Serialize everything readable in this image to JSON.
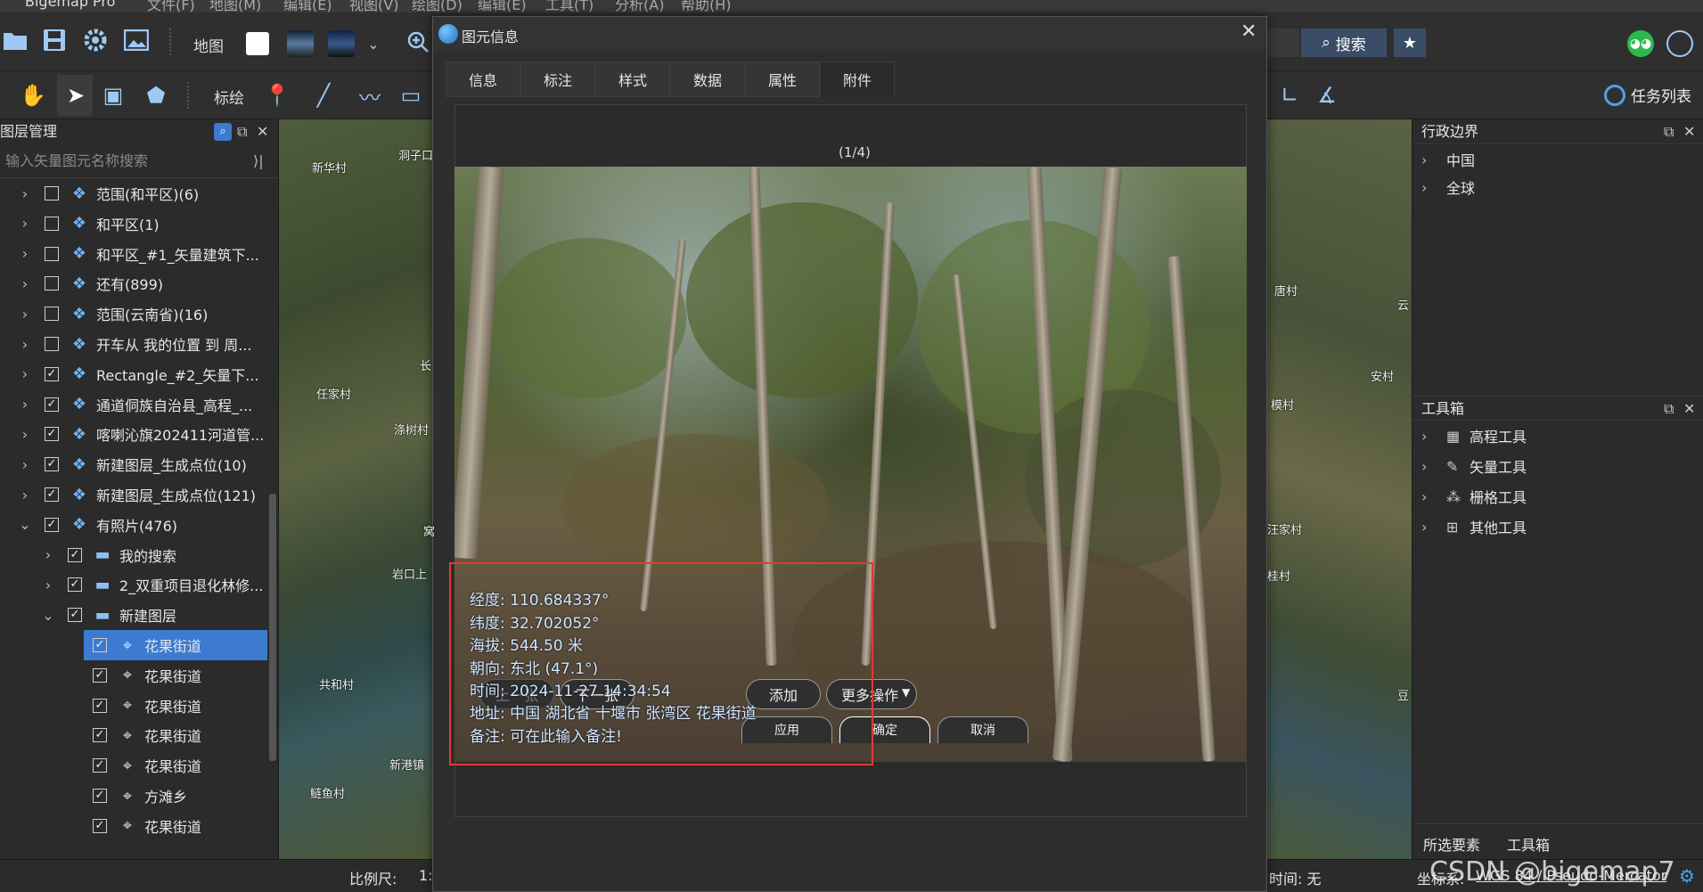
{
  "app": {
    "title_partial": "Bigemap Pro",
    "menus": [
      "文件(F)",
      "地图(M)",
      "编辑(E)",
      "视图(V)",
      "绘图(D)",
      "编辑(E)",
      "工具(T)",
      "分析(A)",
      "帮助(H)"
    ]
  },
  "toolbar": {
    "map_label": "地图",
    "mark_label": "标绘",
    "search_label": "搜索",
    "task_list_label": "任务列表",
    "icons": [
      "folder-icon",
      "save-icon",
      "settings-icon",
      "image-icon",
      "hand-icon",
      "pointer-icon",
      "marker-icon",
      "line-icon",
      "rectangle-icon",
      "zoom-in-icon",
      "star-icon",
      "wechat-icon"
    ]
  },
  "layer_panel": {
    "title": "图层管理",
    "search_placeholder": "输入矢量图元名称搜索",
    "items": [
      {
        "label": "范围(和平区)(6)",
        "checked": false,
        "level": 0,
        "icon": "layers-icon"
      },
      {
        "label": "和平区(1)",
        "checked": false,
        "level": 0,
        "icon": "layers-icon"
      },
      {
        "label": "和平区_#1_矢量建筑下...",
        "checked": false,
        "level": 0,
        "icon": "layers-icon"
      },
      {
        "label": "还有(899)",
        "checked": false,
        "level": 0,
        "icon": "layers-icon"
      },
      {
        "label": "范围(云南省)(16)",
        "checked": false,
        "level": 0,
        "icon": "layers-icon"
      },
      {
        "label": "开车从 我的位置 到 周...",
        "checked": false,
        "level": 0,
        "icon": "layers-icon"
      },
      {
        "label": "Rectangle_#2_矢量下...",
        "checked": true,
        "level": 0,
        "icon": "layers-icon"
      },
      {
        "label": "通道侗族自治县_高程_...",
        "checked": true,
        "level": 0,
        "icon": "layers-icon"
      },
      {
        "label": "喀喇沁旗202411河道管...",
        "checked": true,
        "level": 0,
        "icon": "layers-icon"
      },
      {
        "label": "新建图层_生成点位(10)",
        "checked": true,
        "level": 0,
        "icon": "layers-icon"
      },
      {
        "label": "新建图层_生成点位(121)",
        "checked": true,
        "level": 0,
        "icon": "layers-icon"
      },
      {
        "label": "有照片(476)",
        "checked": true,
        "level": 0,
        "icon": "layers-icon",
        "expanded": true
      },
      {
        "label": "我的搜索",
        "checked": true,
        "level": 1,
        "icon": "folder-icon"
      },
      {
        "label": "2_双重项目退化林修...",
        "checked": true,
        "level": 1,
        "icon": "folder-icon"
      },
      {
        "label": "新建图层",
        "checked": true,
        "level": 1,
        "icon": "folder-icon",
        "expanded": true
      },
      {
        "label": "花果街道",
        "checked": true,
        "level": 2,
        "icon": "pin-icon",
        "selected": true
      },
      {
        "label": "花果街道",
        "checked": true,
        "level": 2,
        "icon": "pin-icon"
      },
      {
        "label": "花果街道",
        "checked": true,
        "level": 2,
        "icon": "pin-icon"
      },
      {
        "label": "花果街道",
        "checked": true,
        "level": 2,
        "icon": "pin-icon"
      },
      {
        "label": "花果街道",
        "checked": true,
        "level": 2,
        "icon": "pin-icon"
      },
      {
        "label": "方滩乡",
        "checked": true,
        "level": 2,
        "icon": "pin-icon"
      },
      {
        "label": "花果街道",
        "checked": true,
        "level": 2,
        "icon": "pin-icon"
      }
    ]
  },
  "map_labels_left": [
    "新华村",
    "洞子口",
    "任家村",
    "涤树村",
    "岩口上",
    "共和村",
    "新港镇",
    "鲢鱼村",
    "长",
    "窝"
  ],
  "map_labels_right": [
    "唐村",
    "安村",
    "模村",
    "汪家村",
    "桂村",
    "云",
    "豆"
  ],
  "admin_panel": {
    "title": "行政边界",
    "items": [
      "中国",
      "全球"
    ]
  },
  "toolbox_panel": {
    "title": "工具箱",
    "items": [
      {
        "label": "高程工具",
        "icon": "elevation-icon"
      },
      {
        "label": "矢量工具",
        "icon": "pen-icon"
      },
      {
        "label": "栅格工具",
        "icon": "grid-icon"
      },
      {
        "label": "其他工具",
        "icon": "apps-icon"
      }
    ],
    "bottom_tabs": [
      "所选要素",
      "工具箱"
    ]
  },
  "statusbar": {
    "scale_label": "比例尺:",
    "scale_value": "1:",
    "time_label": "时间: 无",
    "coords_label": "坐标系:",
    "coords_value": "WGS 84 / Pseudo-Mercator",
    "watermark": "CSDN @bigemap7"
  },
  "dialog": {
    "title": "图元信息",
    "tabs": [
      "信息",
      "标注",
      "样式",
      "数据",
      "属性",
      "附件"
    ],
    "active_tab": "附件",
    "page_counter": "(1/4)",
    "photo_overlay": [
      "经度: 110.684337°",
      "纬度: 32.702052°",
      "海拔: 544.50 米",
      "朝向: 东北 (47.1°)",
      "时间: 2024-11-27 14:34:54",
      "地址: 中国 湖北省 十堰市 张湾区 花果街道",
      "备注: 可在此输入备注!"
    ],
    "buttons": {
      "prev": "上一张",
      "next": "下一张",
      "add": "添加",
      "more": "更多操作",
      "apply": "应用",
      "ok": "确定",
      "cancel": "取消"
    }
  },
  "colors": {
    "accent": "#3c7bd0",
    "highlight_border": "#e23b32",
    "overlay_text": "#cfe8ff"
  }
}
